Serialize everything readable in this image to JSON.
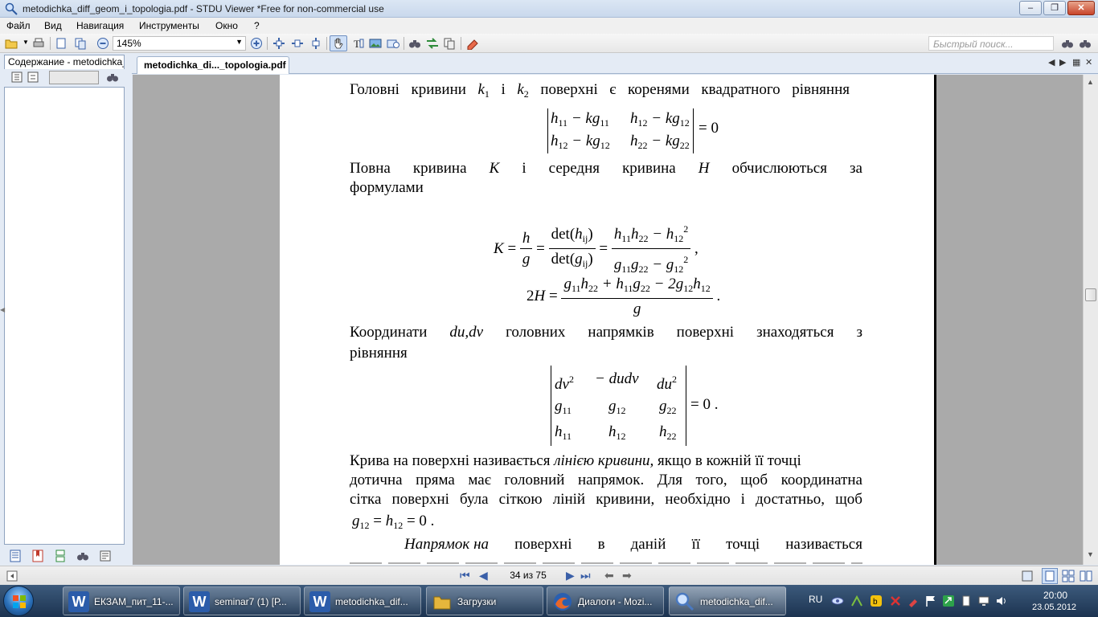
{
  "window": {
    "title": "metodichka_diff_geom_i_topologia.pdf - STDU Viewer *Free for non-commercial use",
    "minimize": "–",
    "maximize": "❐",
    "close": "✕"
  },
  "menu": [
    "Файл",
    "Вид",
    "Навигация",
    "Инструменты",
    "Окно",
    "?"
  ],
  "toolbar": {
    "zoom": "145%",
    "search_placeholder": "Быстрый поиск..."
  },
  "left_panel": {
    "tab_label": "Содержание - metodichka_"
  },
  "doc_tab": {
    "label": "metodichka_di..._topologia.pdf"
  },
  "document": {
    "line1": [
      "Головні",
      "кривини",
      "k₁",
      "і",
      "k₂",
      "поверхні",
      "є",
      "коренями",
      "квадратного",
      "рівняння"
    ],
    "para2_line1": [
      "Повна",
      "кривина",
      "K",
      "і",
      "середня",
      "кривина",
      "H",
      "обчислюються",
      "за"
    ],
    "para2_line2": "формулами",
    "para3_line1": [
      "Координати",
      "du,dv",
      "головних",
      "напрямків",
      "поверхні",
      "знаходяться",
      "з"
    ],
    "para3_line2": "рівняння",
    "para4_line1_a": "Крива на поверхні називається ",
    "para4_line1_b": "лінією кривини,",
    "para4_line1_c": " якщо в кожній її точці",
    "para4_line2": [
      "дотична",
      "пряма",
      "має",
      "головний",
      "напрямок.",
      "Для",
      "того,",
      "щоб",
      "координатна"
    ],
    "para4_line3": [
      "сітка",
      "поверхні",
      "була",
      "сіткою",
      "ліній",
      "кривини,",
      "необхідно",
      "і",
      "достатньо,",
      "щоб"
    ],
    "para5_line1": [
      "Напрямок на",
      "поверхні",
      "в",
      "даній",
      "її",
      "точці",
      "називається"
    ]
  },
  "status": {
    "page_indicator": "34 из 75"
  },
  "taskbar": {
    "tasks": [
      {
        "label": "ЕКЗАМ_пит_11-...",
        "icon": "W"
      },
      {
        "label": "seminar7 (1) [Р...",
        "icon": "W"
      },
      {
        "label": "metodichka_dif...",
        "icon": "W"
      },
      {
        "label": "Загрузки",
        "icon": ""
      },
      {
        "label": "Диалоги - Mozi...",
        "icon": ""
      },
      {
        "label": "metodichka_dif...",
        "icon": ""
      }
    ],
    "lang": "RU",
    "time": "20:00",
    "date": "23.05.2012"
  },
  "colors": {
    "word_blue": "#2b5caa",
    "folder_yellow": "#e6b63c",
    "firefox_orange": "#e8672a",
    "stdu_blue": "#4a79c0"
  }
}
